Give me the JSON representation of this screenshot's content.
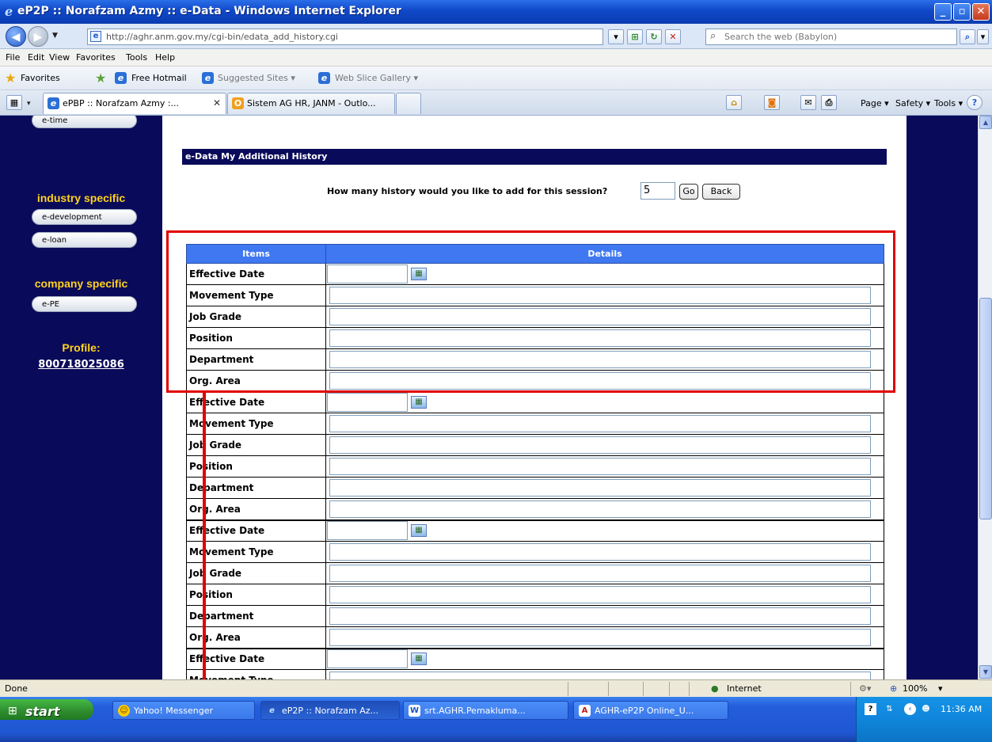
{
  "window": {
    "title": "eP2P :: Norafzam Azmy :: e-Data - Windows Internet Explorer",
    "min": "_",
    "max": "▫",
    "close": "✕"
  },
  "address": {
    "url": "http://aghr.anm.gov.my/cgi-bin/edata_add_history.cgi",
    "search_placeholder": "Search the web (Babylon)"
  },
  "menu": [
    "File",
    "Edit",
    "View",
    "Favorites",
    "Tools",
    "Help"
  ],
  "favorites": {
    "label": "Favorites",
    "items": [
      "Free Hotmail",
      "Suggested Sites ▾",
      "Web Slice Gallery ▾"
    ]
  },
  "tabs": [
    {
      "label": "ePBP :: Norafzam Azmy :...",
      "close": "✕",
      "active": true
    },
    {
      "label": "Sistem AG HR, JANM - Outlo...",
      "active": false
    }
  ],
  "commandbar": [
    "Page ▾",
    "Safety ▾",
    "Tools ▾"
  ],
  "nav": {
    "etime": "e-time",
    "industry_heading": "industry specific",
    "industry_items": [
      "e-development",
      "e-loan"
    ],
    "company_heading": "company specific",
    "company_items": [
      "e-PE"
    ],
    "profile_label": "Profile:",
    "profile_id": "800718025086"
  },
  "page": {
    "section_title": "e-Data My Additional History",
    "question": "How many history would you like to add for this session?",
    "count_value": "5",
    "go_label": "Go",
    "back_label": "Back",
    "table_headers": [
      "Items",
      "Details"
    ],
    "row_labels": [
      "Effective Date",
      "Movement Type",
      "Job Grade",
      "Position",
      "Department",
      "Org. Area"
    ]
  },
  "status": {
    "text": "Done",
    "zone": "Internet",
    "zoom": "100%"
  },
  "taskbar": {
    "start": "start",
    "items": [
      "Yahoo! Messenger",
      "eP2P :: Norafzam Az...",
      "srt.AGHR.Pemakluma...",
      "AGHR-eP2P Online_U..."
    ],
    "clock": "11:36 AM"
  },
  "colors": {
    "page_bg": "#0a0a5a",
    "table_header": "#3f78f0",
    "nav_heading": "#ffd21c",
    "annotation": "#e00000"
  }
}
